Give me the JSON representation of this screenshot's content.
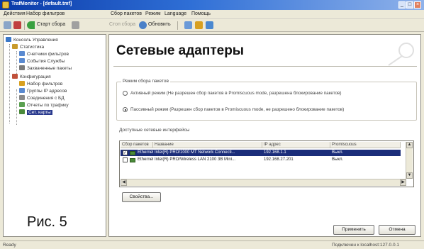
{
  "window": {
    "title": "TrafMonitor - [default.tmf]",
    "minimize_glyph": "_",
    "maximize_glyph": "□",
    "close_glyph": "×"
  },
  "menu": [
    "Действия",
    "Набор фильтров",
    "Сбор пакетов",
    "Режим",
    "Language",
    "Помощь"
  ],
  "toolbar": {
    "start_label": "Старт сбора",
    "stop_label": "Стоп сбора",
    "refresh_label": "Обновить"
  },
  "sidebar": {
    "items": [
      {
        "label": "Консоль Управления",
        "icon": "console-icon",
        "color": "#3a78c8"
      },
      {
        "label": "Статистика",
        "icon": "chart-icon",
        "color": "#c89a2a"
      },
      {
        "label": "Счетчики фильтров",
        "icon": "counter-icon",
        "color": "#5a8ad0"
      },
      {
        "label": "События Службы",
        "icon": "events-icon",
        "color": "#5a8ad0"
      },
      {
        "label": "Захваченные пакеты",
        "icon": "packets-icon",
        "color": "#7a7a7a"
      },
      {
        "label": "Конфигурация",
        "icon": "config-icon",
        "color": "#c0503a"
      },
      {
        "label": "Набор фильтров",
        "icon": "filter-icon",
        "color": "#d8a020"
      },
      {
        "label": "Группы IP адресов",
        "icon": "ip-group-icon",
        "color": "#5a8ad0"
      },
      {
        "label": "Соединения с БД",
        "icon": "database-icon",
        "color": "#8a8a8a"
      },
      {
        "label": "Отчеты по трафику",
        "icon": "report-icon",
        "color": "#5aa050"
      },
      {
        "label": "Сет. карты",
        "icon": "network-card-icon",
        "color": "#4a8a3a"
      }
    ]
  },
  "caption": "Рис. 5",
  "main": {
    "title": "Сетевые адаптеры",
    "mode_group": {
      "legend": "Режим сбора пакетов",
      "option_active": "Активный режим (Не разрешен сбор пакетов в Promiscuous mode, разрешена блокирование пакетов)",
      "option_passive": "Пассивный режим (Разрешен сбор пакетов в Promiscuous mode, не разрешено блокирование пакетов)",
      "selected": "passive"
    },
    "iface_group": {
      "legend": "Доступные сетевые интерфейсы",
      "columns": [
        "Сбор пакетов",
        "Название",
        "IP адрес",
        "Promiscuous"
      ],
      "rows": [
        {
          "checked": true,
          "type": "Ethernet",
          "name": "Intel(R) PRO/1000 MT Network Connecti...",
          "ip": "192.168.1.1",
          "promisc": "Выкл.",
          "selected": true
        },
        {
          "checked": false,
          "type": "Ethernet",
          "name": "Intel(R) PRO/Wireless LAN 2100 3B Mini...",
          "ip": "192.168.27.201",
          "promisc": "Выкл.",
          "selected": false
        }
      ]
    },
    "properties_button": "Свойства...",
    "apply_button": "Применить",
    "cancel_button": "Отмена"
  },
  "status": {
    "left": "Ready",
    "right": "Подключен к localhost:127.0.0.1"
  },
  "colors": {
    "title_bar": "#0a3aa8",
    "selection": "#1b2d7a",
    "chrome": "#ece9d8"
  }
}
